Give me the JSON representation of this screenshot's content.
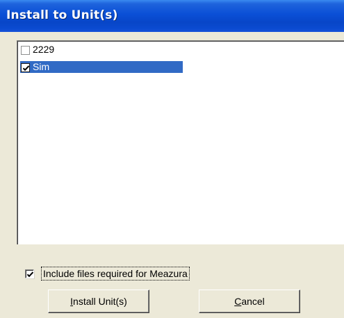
{
  "window": {
    "title": "Install to Unit(s)"
  },
  "unit_list": {
    "items": [
      {
        "label": "2229",
        "checked": false,
        "selected": false
      },
      {
        "label": "Sim",
        "checked": true,
        "selected": true
      }
    ]
  },
  "include_option": {
    "label": "Include files required for Meazura",
    "checked": true
  },
  "buttons": {
    "install": {
      "mnemonic": "I",
      "rest": "nstall Unit(s)"
    },
    "cancel": {
      "mnemonic": "C",
      "rest": "ancel"
    }
  },
  "colors": {
    "titlebar": "#0a4fd6",
    "selection": "#316ac5",
    "dialog_background": "#ece9d8"
  }
}
